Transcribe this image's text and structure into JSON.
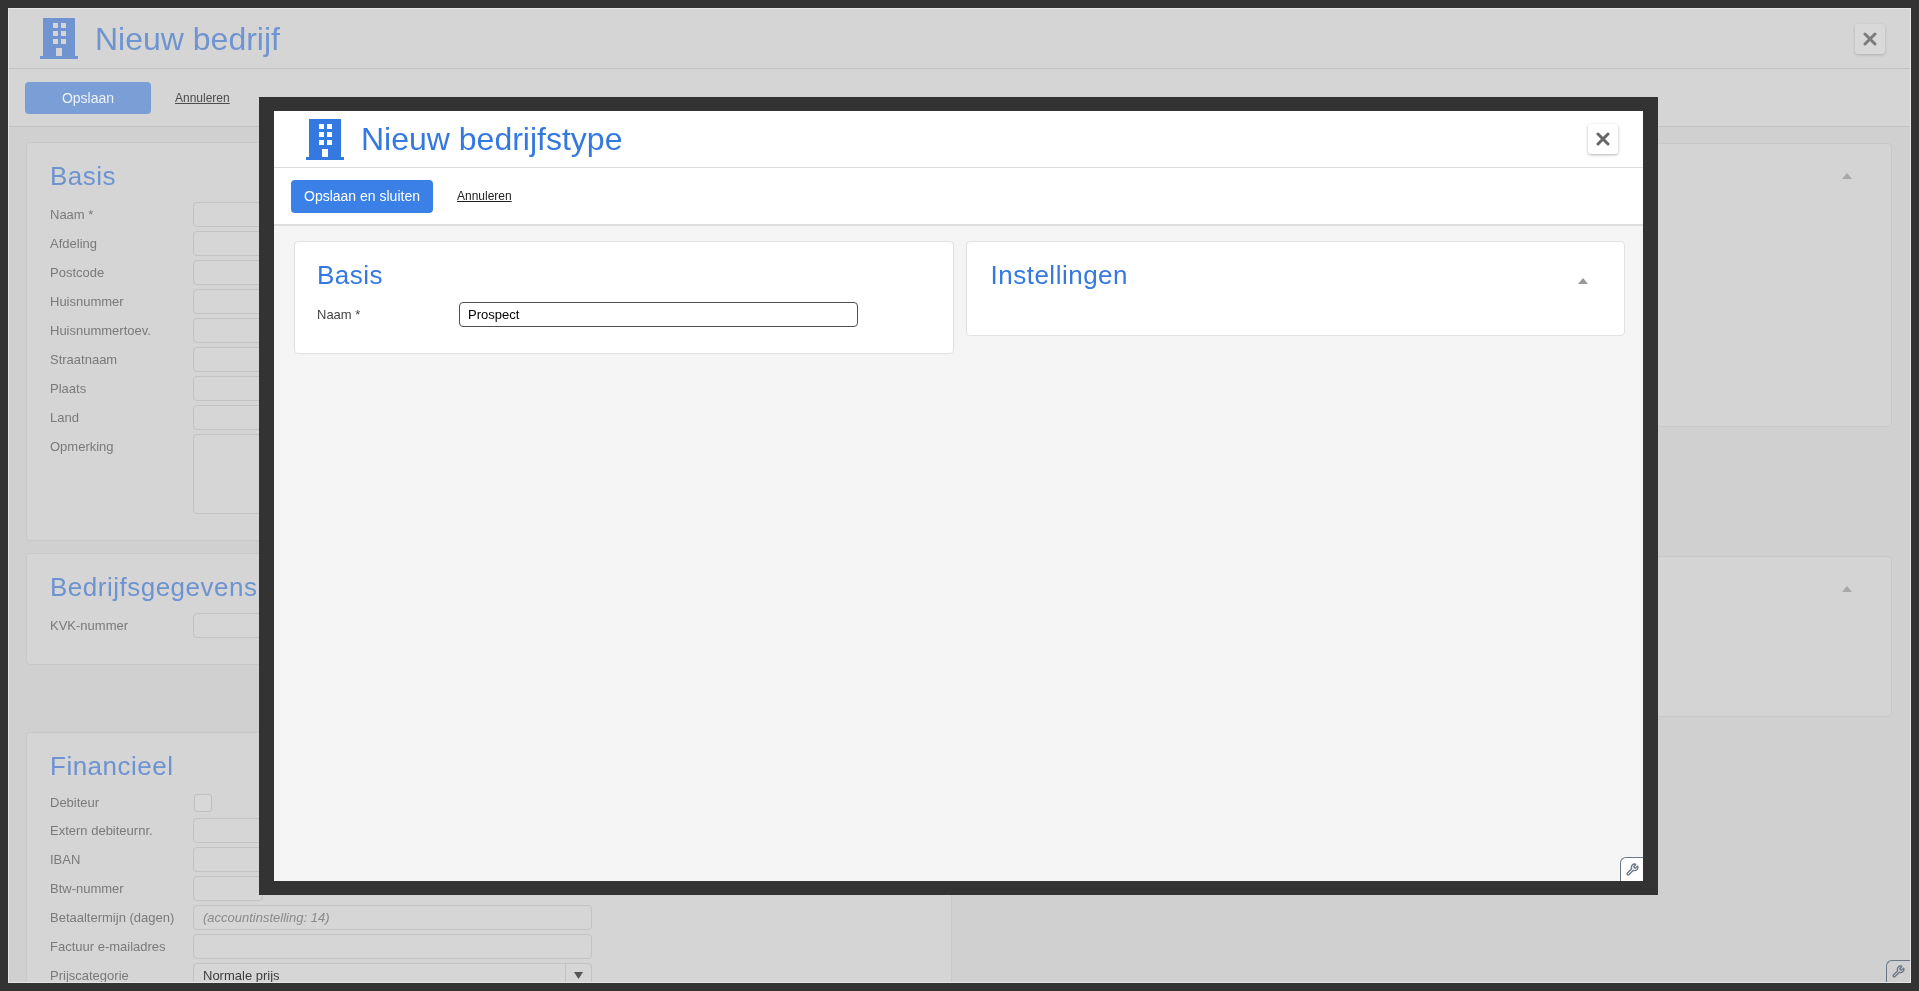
{
  "page": {
    "title": "Nieuw bedrijf",
    "save_button": "Opslaan",
    "cancel_link": "Annuleren",
    "left_sections": [
      {
        "title": "Basis",
        "fields": [
          {
            "label": "Naam *",
            "kind": "text"
          },
          {
            "label": "Afdeling",
            "kind": "text"
          },
          {
            "label": "Postcode",
            "kind": "text"
          },
          {
            "label": "Huisnummer",
            "kind": "text"
          },
          {
            "label": "Huisnummertoev.",
            "kind": "text"
          },
          {
            "label": "Straatnaam",
            "kind": "text"
          },
          {
            "label": "Plaats",
            "kind": "text"
          },
          {
            "label": "Land",
            "kind": "text"
          },
          {
            "label": "Opmerking",
            "kind": "textarea"
          }
        ]
      },
      {
        "title": "Bedrijfsgegevens",
        "fields": [
          {
            "label": "KVK-nummer",
            "kind": "text"
          }
        ]
      },
      {
        "title": "Financieel",
        "fields": [
          {
            "label": "Debiteur",
            "kind": "checkbox",
            "checked": false
          },
          {
            "label": "Extern debiteurnr.",
            "kind": "text"
          },
          {
            "label": "IBAN",
            "kind": "text"
          },
          {
            "label": "Btw-nummer",
            "kind": "text"
          },
          {
            "label": "Betaaltermijn (dagen)",
            "kind": "text",
            "placeholder": "(accountinstelling: 14)"
          },
          {
            "label": "Factuur e-mailadres",
            "kind": "text"
          },
          {
            "label": "Prijscategorie",
            "kind": "select",
            "value": "Normale prijs"
          }
        ]
      }
    ],
    "right_sections": [
      {
        "expanded": true
      },
      {
        "expanded": true
      }
    ]
  },
  "dialog": {
    "title": "Nieuw bedrijfstype",
    "save_button": "Opslaan en sluiten",
    "cancel_link": "Annuleren",
    "sections": [
      {
        "title": "Basis",
        "fields": [
          {
            "label": "Naam *",
            "kind": "text",
            "value": "Prospect",
            "focused": true
          }
        ]
      },
      {
        "title": "Instellingen",
        "expanded": true
      }
    ]
  }
}
